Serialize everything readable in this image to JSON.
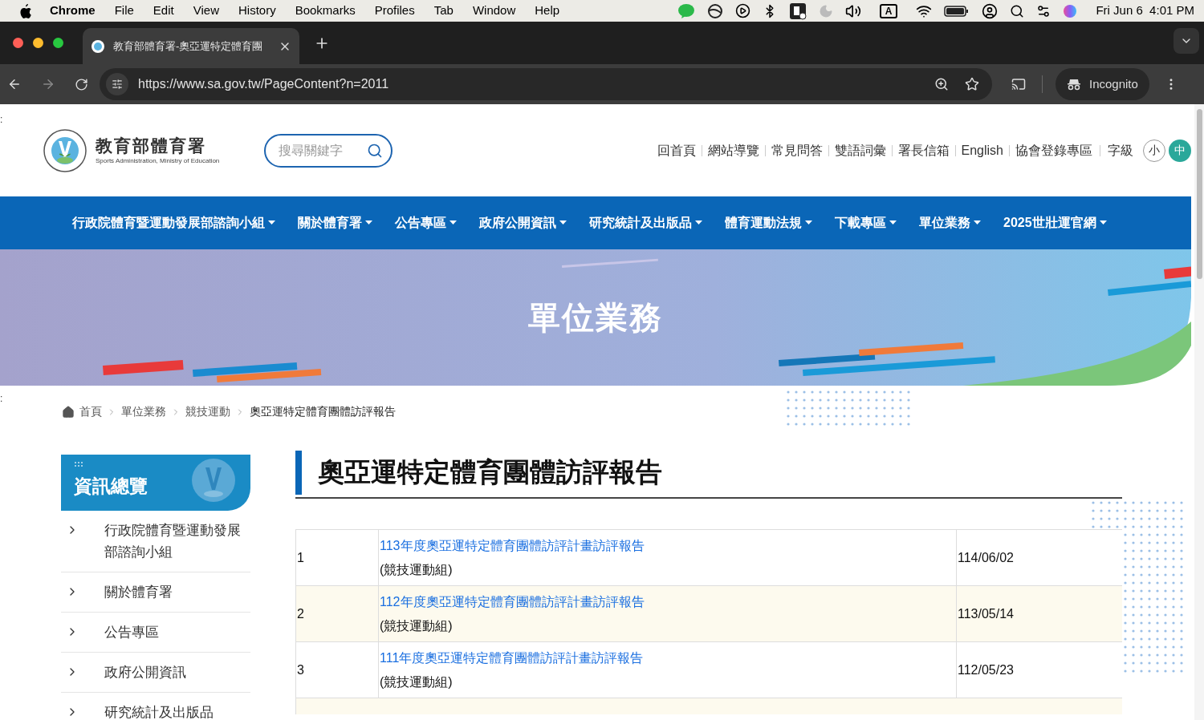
{
  "menu_bar": {
    "app": "Chrome",
    "items": [
      "File",
      "Edit",
      "View",
      "History",
      "Bookmarks",
      "Profiles",
      "Tab",
      "Window",
      "Help"
    ],
    "input_source": "A",
    "clock": "Fri Jun 6  4:01 PM"
  },
  "browser": {
    "tab": {
      "title": "教育部體育署-奧亞運特定體育團",
      "selected": true
    },
    "url": "https://www.sa.gov.tw/PageContent?n=2011",
    "profile": "Incognito"
  },
  "stray_marks": [
    ":",
    ":"
  ],
  "header": {
    "site_name": "教育部體育署",
    "site_subtitle": "Sports Administration, Ministry of Education",
    "search": {
      "placeholder": "搜尋關鍵字"
    },
    "links": [
      "回首頁",
      "網站導覽",
      "常見問答",
      "雙語詞彙",
      "署長信箱",
      "English",
      "協會登錄專區"
    ],
    "font_size": {
      "label": "字級",
      "options": [
        {
          "label": "小",
          "selected": false
        },
        {
          "label": "中",
          "selected": true
        }
      ]
    }
  },
  "nav": [
    "行政院體育暨運動發展部諮詢小組",
    "關於體育署",
    "公告專區",
    "政府公開資訊",
    "研究統計及出版品",
    "體育運動法規",
    "下載專區",
    "單位業務",
    "2025世壯運官網"
  ],
  "banner": {
    "title": "單位業務"
  },
  "breadcrumb": [
    "首頁",
    "單位業務",
    "競技運動",
    "奧亞運特定體育團體訪評報告"
  ],
  "sidebar": {
    "title": "資訊總覽",
    "items": [
      "行政院體育暨運動發展部諮詢小組",
      "關於體育署",
      "公告專區",
      "政府公開資訊",
      "研究統計及出版品"
    ]
  },
  "page_title": "奧亞運特定體育團體訪評報告",
  "table": {
    "rows": [
      {
        "number": "1",
        "title": "113年度奧亞運特定體育團體訪評計畫訪評報告",
        "unit": "(競技運動組)",
        "date": "114/06/02"
      },
      {
        "number": "2",
        "title": "112年度奧亞運特定體育團體訪評計畫訪評報告",
        "unit": "(競技運動組)",
        "date": "113/05/14"
      },
      {
        "number": "3",
        "title": "111年度奧亞運特定體育團體訪評計畫訪評報告",
        "unit": "(競技運動組)",
        "date": "112/05/23"
      }
    ]
  }
}
